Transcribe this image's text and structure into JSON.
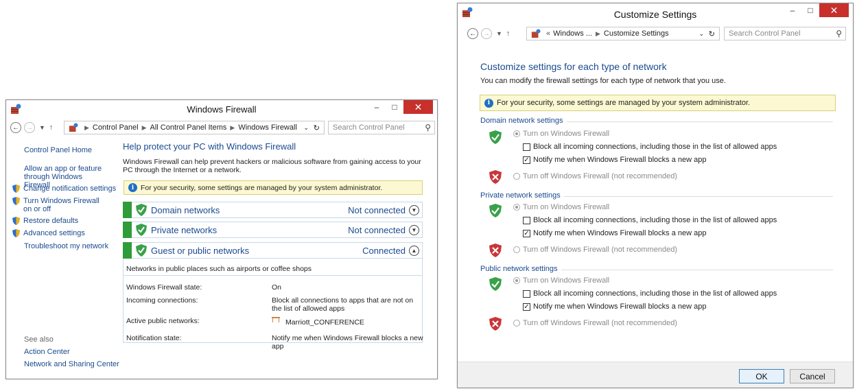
{
  "firewall": {
    "title": "Windows Firewall",
    "breadcrumb": [
      "Control Panel",
      "All Control Panel Items",
      "Windows Firewall"
    ],
    "search_placeholder": "Search Control Panel",
    "sidebar": {
      "home": "Control Panel Home",
      "items": [
        {
          "label": "Allow an app or feature through Windows Firewall",
          "icon": "none"
        },
        {
          "label": "Change notification settings",
          "icon": "shield-icon"
        },
        {
          "label": "Turn Windows Firewall on or off",
          "icon": "shield-icon"
        },
        {
          "label": "Restore defaults",
          "icon": "shield-icon"
        },
        {
          "label": "Advanced settings",
          "icon": "shield-icon"
        },
        {
          "label": "Troubleshoot my network",
          "icon": "none"
        }
      ],
      "see_also": "See also",
      "see_also_items": [
        "Action Center",
        "Network and Sharing Center"
      ]
    },
    "heading": "Help protect your PC with Windows Firewall",
    "description": "Windows Firewall can help prevent hackers or malicious software from gaining access to your PC through the Internet or a network.",
    "info": "For your security, some settings are managed by your system administrator.",
    "networks": [
      {
        "name": "Domain networks",
        "status": "Not connected",
        "expanded": false
      },
      {
        "name": "Private networks",
        "status": "Not connected",
        "expanded": false
      },
      {
        "name": "Guest or public networks",
        "status": "Connected",
        "expanded": true
      }
    ],
    "public_desc": "Networks in public places such as airports or coffee shops",
    "details": [
      {
        "label": "Windows Firewall state:",
        "value": "On"
      },
      {
        "label": "Incoming connections:",
        "value": "Block all connections to apps that are not on the list of allowed apps"
      },
      {
        "label": "Active public networks:",
        "value": "Marriott_CONFERENCE"
      },
      {
        "label": "Notification state:",
        "value": "Notify me when Windows Firewall blocks a new app"
      }
    ]
  },
  "customize": {
    "title": "Customize Settings",
    "breadcrumb": [
      "Windows ...",
      "Customize Settings"
    ],
    "search_placeholder": "Search Control Panel",
    "heading": "Customize settings for each type of network",
    "subheading": "You can modify the firewall settings for each type of network that you use.",
    "info": "For your security, some settings are managed by your system administrator.",
    "sections": [
      {
        "title": "Domain network settings"
      },
      {
        "title": "Private network settings"
      },
      {
        "title": "Public network settings"
      }
    ],
    "turn_on": "Turn on Windows Firewall",
    "block_all": "Block all incoming connections, including those in the list of allowed apps",
    "notify": "Notify me when Windows Firewall blocks a new app",
    "turn_off": "Turn off Windows Firewall (not recommended)",
    "ok": "OK",
    "cancel": "Cancel"
  },
  "colors": {
    "accent_link": "#1a4a8e",
    "close_red": "#c7302b",
    "green_status": "#2f9c3a",
    "info_bg": "#fcf8d2"
  }
}
